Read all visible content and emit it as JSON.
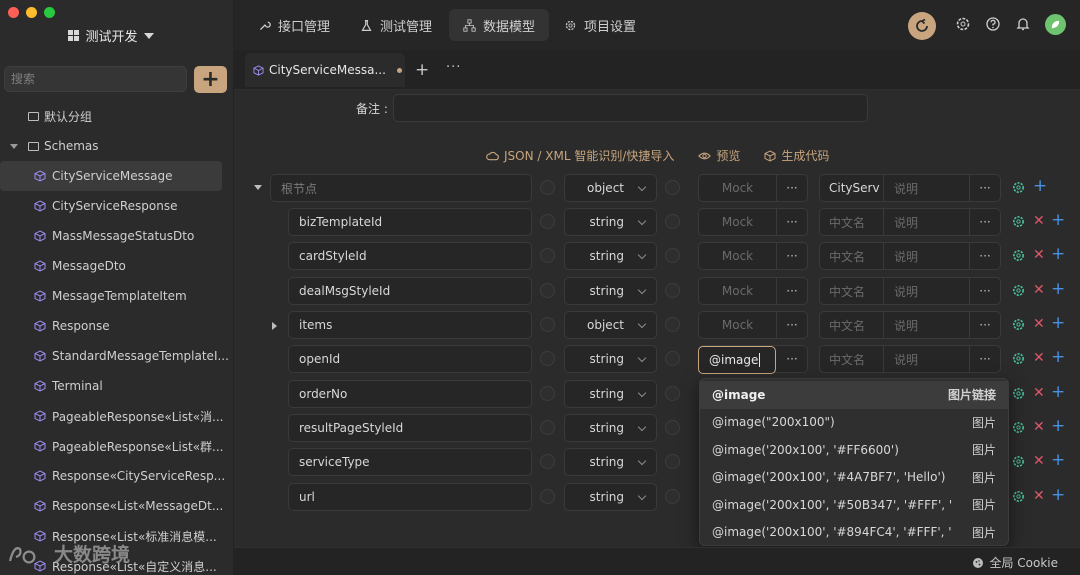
{
  "window": {
    "traffic_colors": [
      "#ff5f57",
      "#febc2e",
      "#28c840"
    ]
  },
  "sidebar": {
    "project_name": "测试开发",
    "search_placeholder": "搜索",
    "add_label": "+",
    "groups": [
      {
        "label": "默认分组"
      },
      {
        "label": "Schemas"
      }
    ],
    "items": [
      "CityServiceMessage",
      "CityServiceResponse",
      "MassMessageStatusDto",
      "MessageDto",
      "MessageTemplateItem",
      "Response",
      "StandardMessageTemplateI...",
      "Terminal",
      "PageableResponse«List«消...",
      "PageableResponse«List«群...",
      "Response«CityServiceResp...",
      "Response«List«MessageDt...",
      "Response«List«标准消息模...",
      "Response«List«自定义消息..."
    ],
    "active_item": "CityServiceMessage"
  },
  "topnav": {
    "tabs": [
      "接口管理",
      "测试管理",
      "数据模型",
      "项目设置"
    ],
    "active_tab": "数据模型"
  },
  "tabbar": {
    "open_tab": "CityServiceMessa...",
    "add": "+",
    "more": "···"
  },
  "editor": {
    "remark_label": "备注 :",
    "actions": {
      "import": "JSON / XML 智能识别/快捷导入",
      "preview": "预览",
      "codegen": "生成代码"
    },
    "root": {
      "name_placeholder": "根节点",
      "type": "object",
      "mock_placeholder": "Mock",
      "title": "CityServ",
      "desc_placeholder": "说明"
    },
    "fields": [
      {
        "name": "bizTemplateId",
        "type": "string",
        "mock": "Mock",
        "title": "中文名",
        "desc": "说明"
      },
      {
        "name": "cardStyleId",
        "type": "string",
        "mock": "Mock",
        "title": "中文名",
        "desc": "说明"
      },
      {
        "name": "dealMsgStyleId",
        "type": "string",
        "mock": "Mock",
        "title": "中文名",
        "desc": "说明"
      },
      {
        "name": "items",
        "type": "object",
        "mock": "Mock",
        "title": "中文名",
        "desc": "说明"
      },
      {
        "name": "openId",
        "type": "string",
        "mock": "@image",
        "title": "中文名",
        "desc": "说明"
      },
      {
        "name": "orderNo",
        "type": "string"
      },
      {
        "name": "resultPageStyleId",
        "type": "string"
      },
      {
        "name": "serviceType",
        "type": "string"
      },
      {
        "name": "url",
        "type": "string"
      }
    ],
    "more": "···",
    "delete": "✕",
    "add": "+"
  },
  "mock_dropdown": [
    {
      "text": "@image",
      "kind": "图片链接"
    },
    {
      "text": "@image(\"200x100\")",
      "kind": "图片"
    },
    {
      "text": "@image('200x100', '#FF6600')",
      "kind": "图片"
    },
    {
      "text": "@image('200x100', '#4A7BF7', 'Hello')",
      "kind": "图片"
    },
    {
      "text": "@image('200x100', '#50B347', '#FFF', '...",
      "kind": "图片"
    },
    {
      "text": "@image('200x100', '#894FC4', '#FFF', '...",
      "kind": "图片"
    }
  ],
  "statusbar": {
    "cookie": "全局 Cookie"
  },
  "watermark": "大数跨境",
  "colors": {
    "accent": "#c8a57e",
    "danger": "#e0556a",
    "link": "#4a90e2",
    "gear": "#49c5a0"
  }
}
